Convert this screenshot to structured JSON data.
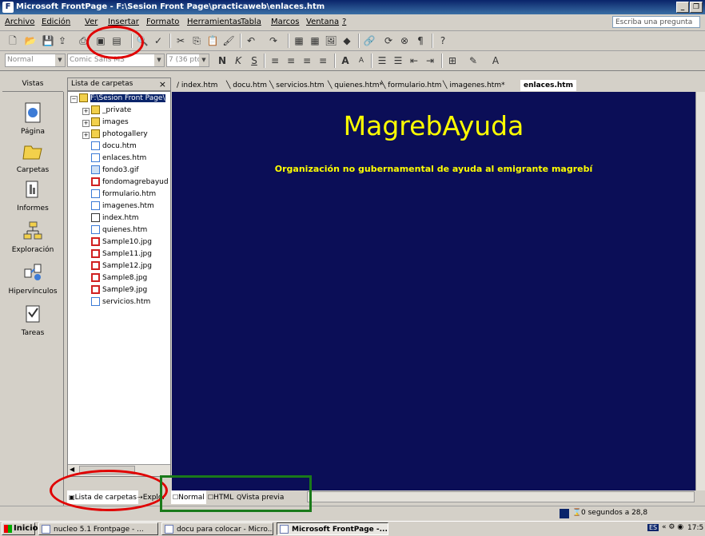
{
  "window": {
    "title": "Microsoft FrontPage - F:\\Sesion Front Page\\practicaweb\\enlaces.htm",
    "minimize_label": "_",
    "restore_label": "❐"
  },
  "menu": [
    "Archivo",
    "Edición",
    "Ver",
    "Insertar",
    "Formato",
    "Herramientas",
    "Tabla",
    "Marcos",
    "Ventana",
    "?"
  ],
  "help_box": "Escriba una pregunta",
  "formatting": {
    "style": "Normal",
    "font": "Comic Sans MS",
    "size": "7 (36 pto"
  },
  "views": {
    "header": "Vistas",
    "items": [
      "Página",
      "Carpetas",
      "Informes",
      "Exploración",
      "Hipervínculos",
      "Tareas"
    ]
  },
  "folder_list": {
    "header": "Lista de carpetas",
    "close": "×",
    "root": "F:\\Sesion Front Page\\",
    "folders": [
      "_private",
      "images",
      "photogallery"
    ],
    "files": [
      "docu.htm",
      "enlaces.htm",
      "fondo3.gif",
      "fondomagrebayud",
      "formulario.htm",
      "imagenes.htm",
      "index.htm",
      "quienes.htm",
      "Sample10.jpg",
      "Sample11.jpg",
      "Sample12.jpg",
      "Sample8.jpg",
      "Sample9.jpg",
      "servicios.htm"
    ]
  },
  "doc_tabs": [
    "index.htm",
    "docu.htm",
    "servicios.htm",
    "quienes.htm*",
    "formulario.htm",
    "imagenes.htm*",
    "enlaces.htm"
  ],
  "page": {
    "heading": "MagrebAyuda",
    "subtitle": "Organización no gubernamental de ayuda al emigrante magrebí",
    "background": "#0b0e57",
    "text_color": "#ffff00"
  },
  "bottom_tabs": {
    "folder_list": "Lista de carpetas",
    "explorer": "Explor",
    "normal": "Normal",
    "html": "HTML",
    "preview": "Vista previa"
  },
  "status": "0 segundos a 28,8",
  "taskbar": {
    "start": "Inicio",
    "tasks": [
      "nucleo 5.1 Frontpage - ...",
      "docu para colocar - Micro...",
      "Microsoft FrontPage -..."
    ],
    "clock": "17:5",
    "lang": "ES"
  },
  "annotation_colors": {
    "red": "#e00000",
    "green": "#1a7a1a"
  }
}
